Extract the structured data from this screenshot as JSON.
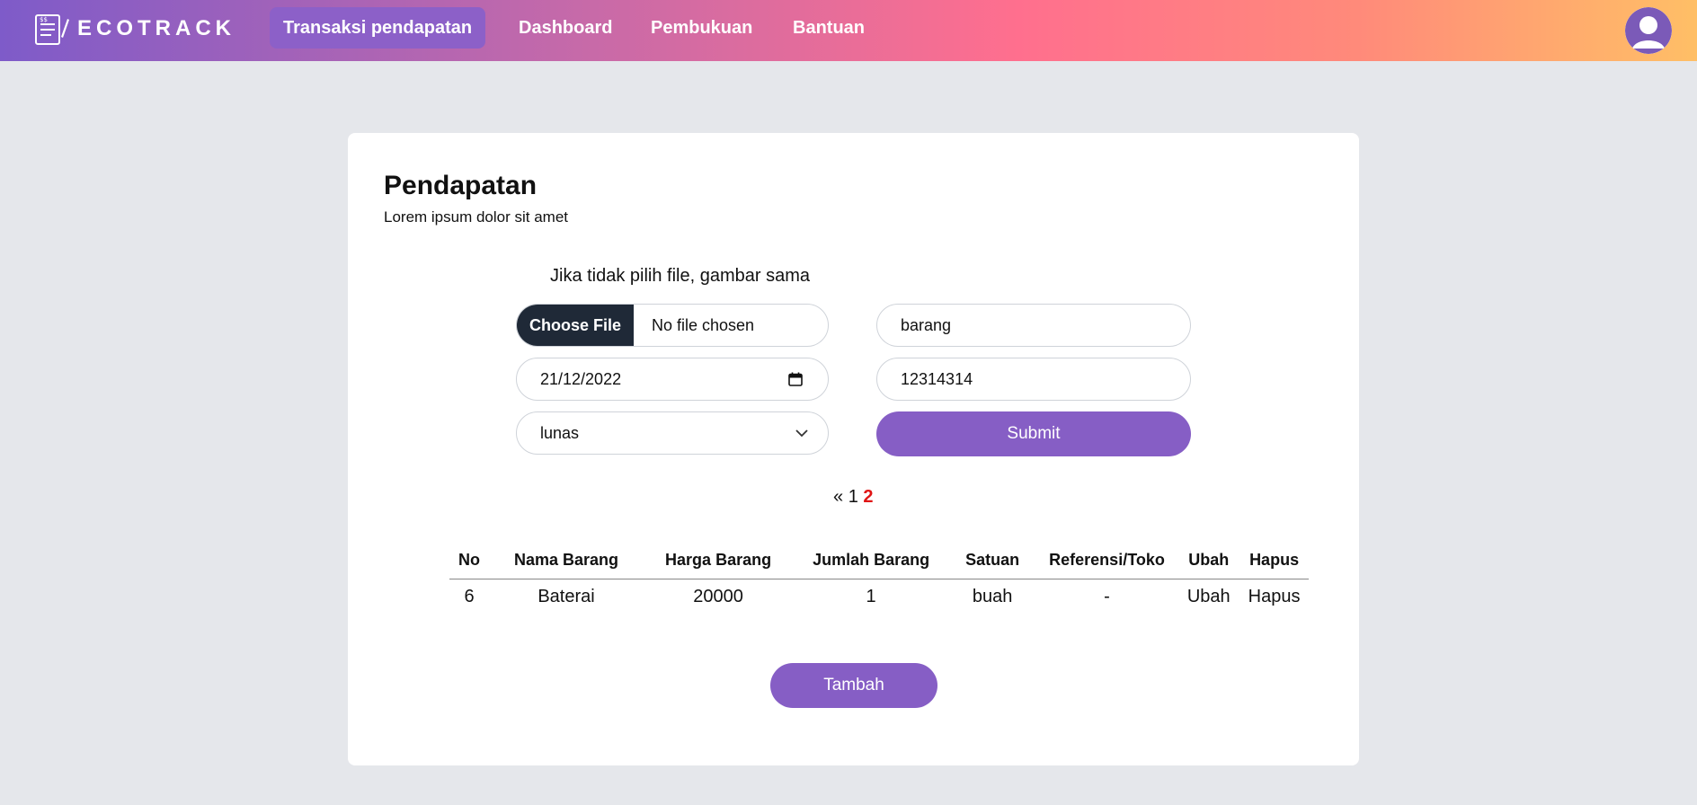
{
  "nav": {
    "logo": "ECOTRACK",
    "items": [
      {
        "label": "Transaksi pendapatan",
        "active": true
      },
      {
        "label": "Dashboard"
      },
      {
        "label": "Pembukuan"
      },
      {
        "label": "Bantuan"
      }
    ],
    "avatar_icon": "user-avatar-icon"
  },
  "card": {
    "title": "Pendapatan",
    "subtitle": "Lorem ipsum dolor sit amet",
    "hint": "Jika tidak pilih file, gambar sama"
  },
  "form": {
    "file_button": "Choose File",
    "file_status": "No file chosen",
    "date": "21/12/2022",
    "status_select": "lunas",
    "name": "barang",
    "number": "12314314",
    "submit": "Submit"
  },
  "pagination": {
    "prev": "«",
    "pages": [
      "1",
      "2"
    ],
    "current": "2"
  },
  "table": {
    "headers": [
      "No",
      "Nama Barang",
      "Harga Barang",
      "Jumlah Barang",
      "Satuan",
      "Referensi/Toko",
      "Ubah",
      "Hapus"
    ],
    "rows": [
      [
        "6",
        "Baterai",
        "20000",
        "1",
        "buah",
        "-",
        "Ubah",
        "Hapus"
      ]
    ]
  },
  "actions": {
    "add": "Tambah"
  },
  "colors": {
    "accent": "#865ec5",
    "dark_button": "#1f2937",
    "current_page": "#e01414",
    "background": "#e5e7eb"
  }
}
